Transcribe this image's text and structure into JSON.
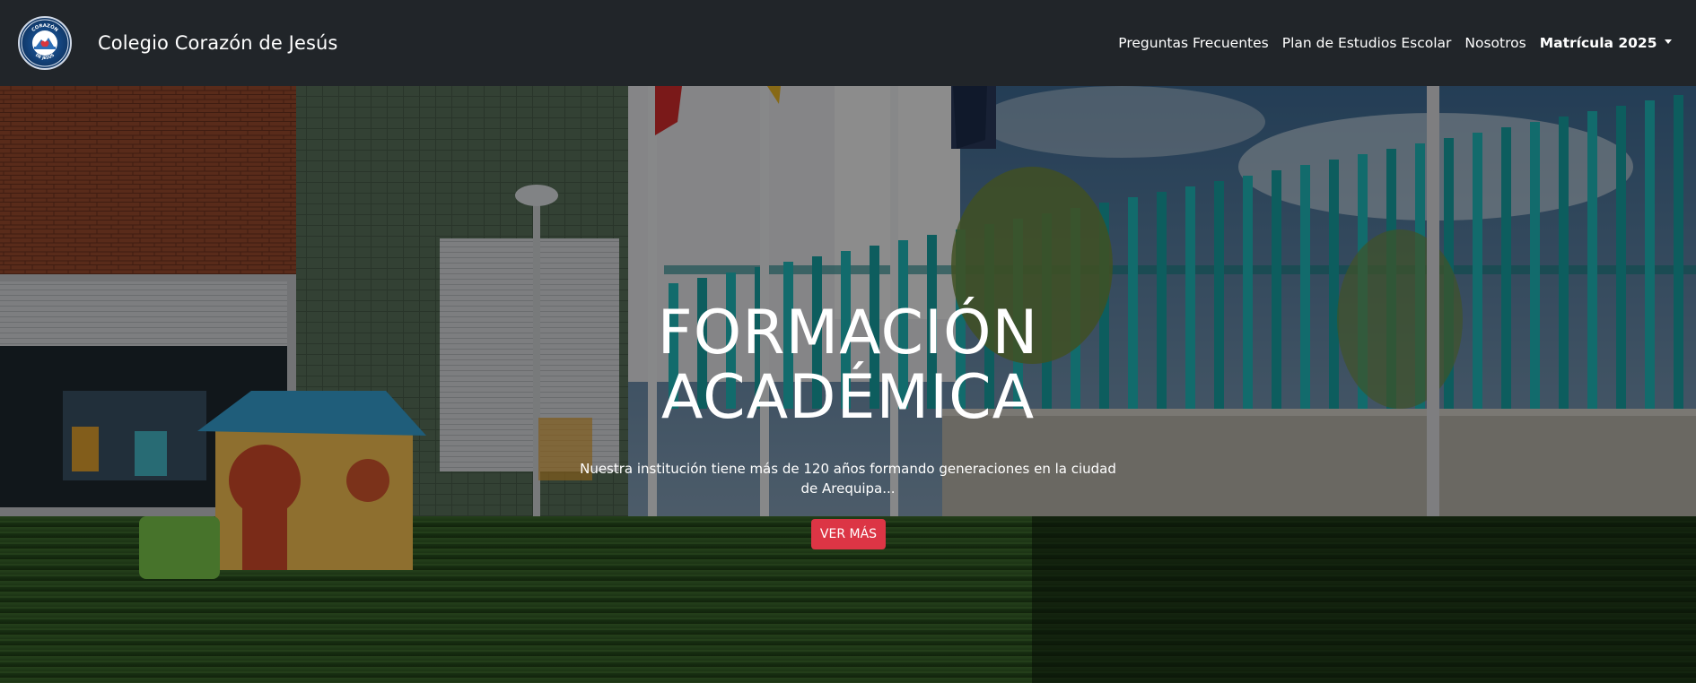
{
  "navbar": {
    "brand": "Colegio Corazón de Jesús",
    "logo_text_top": "CORAZÓN",
    "logo_text_bottom": "DE JESÚS",
    "links": [
      {
        "label": "Preguntas Frecuentes"
      },
      {
        "label": "Plan de Estudios Escolar"
      },
      {
        "label": "Nosotros"
      },
      {
        "label": "Matrícula 2025"
      }
    ]
  },
  "hero": {
    "title_line1": "FORMACIÓN",
    "title_line2": "ACADÉMICA",
    "description": "Nuestra institución tiene más de 120 años formando generaciones en la ciudad de Arequipa...",
    "button": "VER MÁS"
  },
  "colors": {
    "navbar_bg": "#212529",
    "button_bg": "#dc3545",
    "text": "#ffffff"
  }
}
